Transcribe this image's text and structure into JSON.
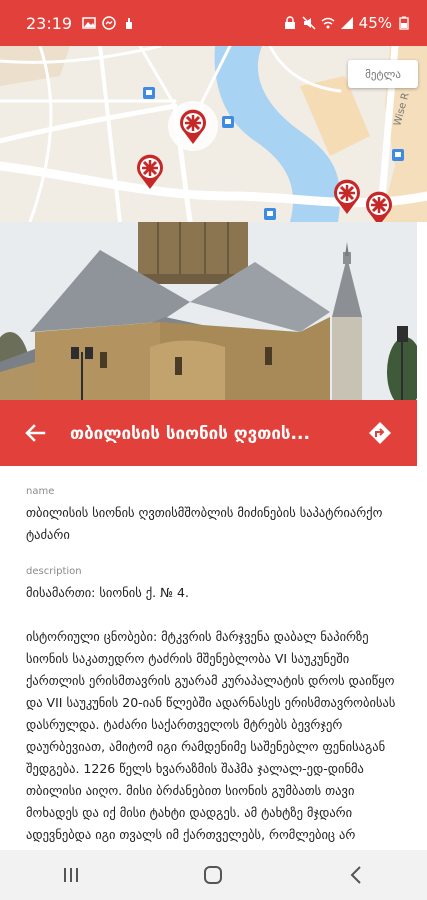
{
  "status_bar": {
    "time": "23:19",
    "battery": "45%",
    "icons": [
      "image-icon",
      "messenger-icon",
      "hand-icon",
      "lock-icon",
      "mute-icon",
      "wifi-icon",
      "signal-icon",
      "battery-icon"
    ]
  },
  "map": {
    "button_label": "მეტლა",
    "road_label": "Wise R",
    "markers": [
      "church-marker-icon",
      "church-marker-icon",
      "church-marker-icon",
      "church-marker-icon"
    ],
    "colors": {
      "water": "#a8d3f2",
      "roads": "#ffffff",
      "land": "#f1ece4",
      "parks": "#f7d6a1",
      "bus": "#3d8be3"
    }
  },
  "header": {
    "title": "თბილისის სიონის ღვთის...",
    "back_icon": "arrow-left-icon",
    "directions_icon": "directions-icon"
  },
  "details": {
    "name_label": "name",
    "name_value": "თბილისის სიონის ღვთისმშობლის მიძინების საპატრიარქო ტაძარი",
    "description_label": "description",
    "description_address": "მისამართი: სიონის ქ. № 4.",
    "description_history": "ისტორიული ცნობები: მტკვრის მარჯვენა დაბალ ნაპირზე სიონის საკათედრო ტაძრის მშენებლობა VI საუკუნეში ქართლის ერისმთავრის გუარამ კურაპალატის დროს დაიწყო და VII საუკუნის 20-იან წლებში ადარნასეს ერისმთავრობისას დასრულდა. ტაძარი საქართველოს მტრებს ბევრჯერ დაურბევიათ, ამიტომ იგი რამდენიმე საშენებლო ფენისაგან შედგება. 1226 წელს ხვარაზმის შაჰმა ჯალალ-ედ-დინმა თბილისი აიღო. მისი ბრძანებით სიონის გუმბათს თავი მოხადეს და იქ მისი ტახტი დადგეს. ამ ტახტზე მჯდარი ადევნებდა იგი თვალს იმ ქართველებს, რომლებიც არ შეურაცხყოფდნენ სიონის"
  },
  "nav": {
    "recents_icon": "recents-icon",
    "home_icon": "home-icon",
    "back_icon": "chevron-left-icon"
  }
}
